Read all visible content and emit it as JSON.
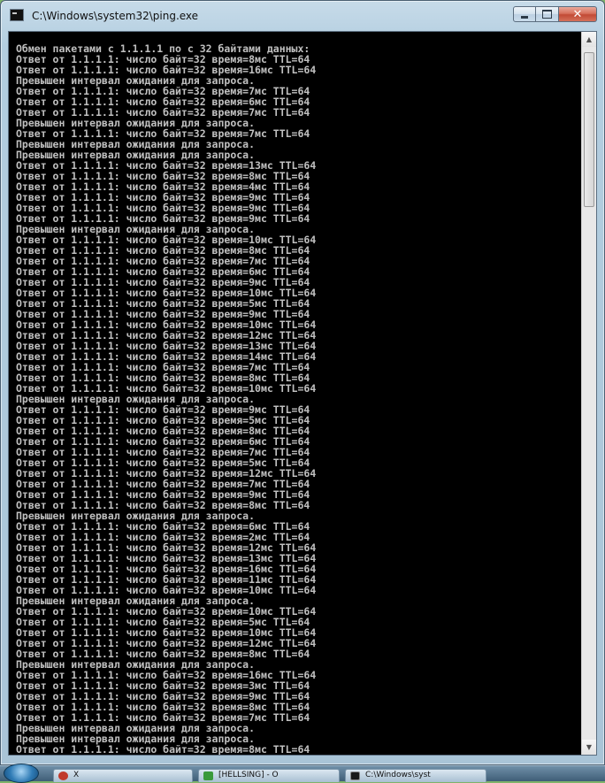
{
  "window": {
    "title": "C:\\Windows\\system32\\ping.exe",
    "controls": {
      "minimize": "",
      "maximize": "",
      "close": "✕"
    }
  },
  "console": {
    "lines": [
      "Обмен пакетами с 1.1.1.1 по с 32 байтами данных:",
      "Ответ от 1.1.1.1: число байт=32 время=8мс TTL=64",
      "Ответ от 1.1.1.1: число байт=32 время=16мс TTL=64",
      "Превышен интервал ожидания для запроса.",
      "Ответ от 1.1.1.1: число байт=32 время=7мс TTL=64",
      "Ответ от 1.1.1.1: число байт=32 время=6мс TTL=64",
      "Ответ от 1.1.1.1: число байт=32 время=7мс TTL=64",
      "Превышен интервал ожидания для запроса.",
      "Ответ от 1.1.1.1: число байт=32 время=7мс TTL=64",
      "Превышен интервал ожидания для запроса.",
      "Превышен интервал ожидания для запроса.",
      "Ответ от 1.1.1.1: число байт=32 время=13мс TTL=64",
      "Ответ от 1.1.1.1: число байт=32 время=8мс TTL=64",
      "Ответ от 1.1.1.1: число байт=32 время=4мс TTL=64",
      "Ответ от 1.1.1.1: число байт=32 время=9мс TTL=64",
      "Ответ от 1.1.1.1: число байт=32 время=9мс TTL=64",
      "Ответ от 1.1.1.1: число байт=32 время=9мс TTL=64",
      "Превышен интервал ожидания для запроса.",
      "Ответ от 1.1.1.1: число байт=32 время=10мс TTL=64",
      "Ответ от 1.1.1.1: число байт=32 время=8мс TTL=64",
      "Ответ от 1.1.1.1: число байт=32 время=7мс TTL=64",
      "Ответ от 1.1.1.1: число байт=32 время=6мс TTL=64",
      "Ответ от 1.1.1.1: число байт=32 время=9мс TTL=64",
      "Ответ от 1.1.1.1: число байт=32 время=10мс TTL=64",
      "Ответ от 1.1.1.1: число байт=32 время=5мс TTL=64",
      "Ответ от 1.1.1.1: число байт=32 время=9мс TTL=64",
      "Ответ от 1.1.1.1: число байт=32 время=10мс TTL=64",
      "Ответ от 1.1.1.1: число байт=32 время=12мс TTL=64",
      "Ответ от 1.1.1.1: число байт=32 время=13мс TTL=64",
      "Ответ от 1.1.1.1: число байт=32 время=14мс TTL=64",
      "Ответ от 1.1.1.1: число байт=32 время=7мс TTL=64",
      "Ответ от 1.1.1.1: число байт=32 время=8мс TTL=64",
      "Ответ от 1.1.1.1: число байт=32 время=10мс TTL=64",
      "Превышен интервал ожидания для запроса.",
      "Ответ от 1.1.1.1: число байт=32 время=9мс TTL=64",
      "Ответ от 1.1.1.1: число байт=32 время=5мс TTL=64",
      "Ответ от 1.1.1.1: число байт=32 время=8мс TTL=64",
      "Ответ от 1.1.1.1: число байт=32 время=6мс TTL=64",
      "Ответ от 1.1.1.1: число байт=32 время=7мс TTL=64",
      "Ответ от 1.1.1.1: число байт=32 время=5мс TTL=64",
      "Ответ от 1.1.1.1: число байт=32 время=12мс TTL=64",
      "Ответ от 1.1.1.1: число байт=32 время=7мс TTL=64",
      "Ответ от 1.1.1.1: число байт=32 время=9мс TTL=64",
      "Ответ от 1.1.1.1: число байт=32 время=8мс TTL=64",
      "Превышен интервал ожидания для запроса.",
      "Ответ от 1.1.1.1: число байт=32 время=6мс TTL=64",
      "Ответ от 1.1.1.1: число байт=32 время=2мс TTL=64",
      "Ответ от 1.1.1.1: число байт=32 время=12мс TTL=64",
      "Ответ от 1.1.1.1: число байт=32 время=13мс TTL=64",
      "Ответ от 1.1.1.1: число байт=32 время=16мс TTL=64",
      "Ответ от 1.1.1.1: число байт=32 время=11мс TTL=64",
      "Ответ от 1.1.1.1: число байт=32 время=10мс TTL=64",
      "Превышен интервал ожидания для запроса.",
      "Ответ от 1.1.1.1: число байт=32 время=10мс TTL=64",
      "Ответ от 1.1.1.1: число байт=32 время=5мс TTL=64",
      "Ответ от 1.1.1.1: число байт=32 время=10мс TTL=64",
      "Ответ от 1.1.1.1: число байт=32 время=12мс TTL=64",
      "Ответ от 1.1.1.1: число байт=32 время=8мс TTL=64",
      "Превышен интервал ожидания для запроса.",
      "Ответ от 1.1.1.1: число байт=32 время=16мс TTL=64",
      "Ответ от 1.1.1.1: число байт=32 время=3мс TTL=64",
      "Ответ от 1.1.1.1: число байт=32 время=9мс TTL=64",
      "Ответ от 1.1.1.1: число байт=32 время=8мс TTL=64",
      "Ответ от 1.1.1.1: число байт=32 время=7мс TTL=64",
      "Превышен интервал ожидания для запроса.",
      "Превышен интервал ожидания для запроса.",
      "Ответ от 1.1.1.1: число байт=32 время=8мс TTL=64"
    ],
    "scroll_position": 0.2
  },
  "scrollbar": {
    "up_arrow": "▲",
    "down_arrow": "▼"
  },
  "taskbar": {
    "items": [
      {
        "label": "Х",
        "icon": "opera-icon",
        "color": "#c0392b"
      },
      {
        "label": "[HELLSING] - О",
        "icon": "utorrent-icon",
        "color": "#3a9a3a"
      },
      {
        "label": "C:\\Windows\\syst",
        "icon": "console-icon",
        "color": "#1a1a1a"
      }
    ]
  },
  "colors": {
    "console_bg": "#000000",
    "console_text": "#c0c0c0",
    "close_button": "#c24a35"
  }
}
